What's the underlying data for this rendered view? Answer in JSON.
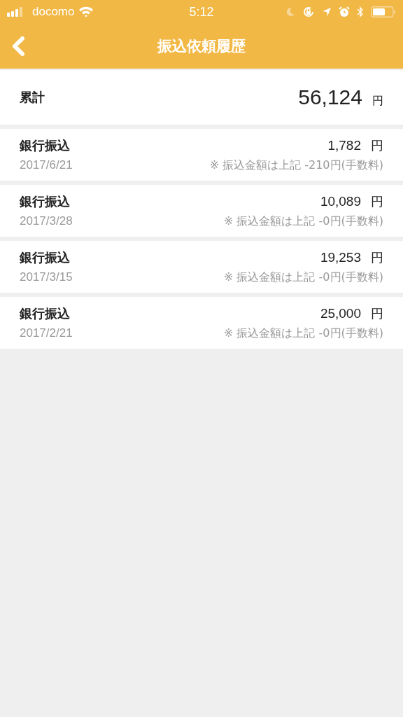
{
  "status_bar": {
    "carrier": "docomo",
    "time": "5:12"
  },
  "nav": {
    "title": "振込依頼履歴"
  },
  "total": {
    "label": "累計",
    "amount": "56,124",
    "unit": "円"
  },
  "transfers": [
    {
      "type": "銀行振込",
      "date": "2017/6/21",
      "amount": "1,782",
      "unit": "円",
      "note": "※ 振込金額は上記 -210円(手数料)"
    },
    {
      "type": "銀行振込",
      "date": "2017/3/28",
      "amount": "10,089",
      "unit": "円",
      "note": "※ 振込金額は上記 -0円(手数料)"
    },
    {
      "type": "銀行振込",
      "date": "2017/3/15",
      "amount": "19,253",
      "unit": "円",
      "note": "※ 振込金額は上記 -0円(手数料)"
    },
    {
      "type": "銀行振込",
      "date": "2017/2/21",
      "amount": "25,000",
      "unit": "円",
      "note": "※ 振込金額は上記 -0円(手数料)"
    }
  ]
}
